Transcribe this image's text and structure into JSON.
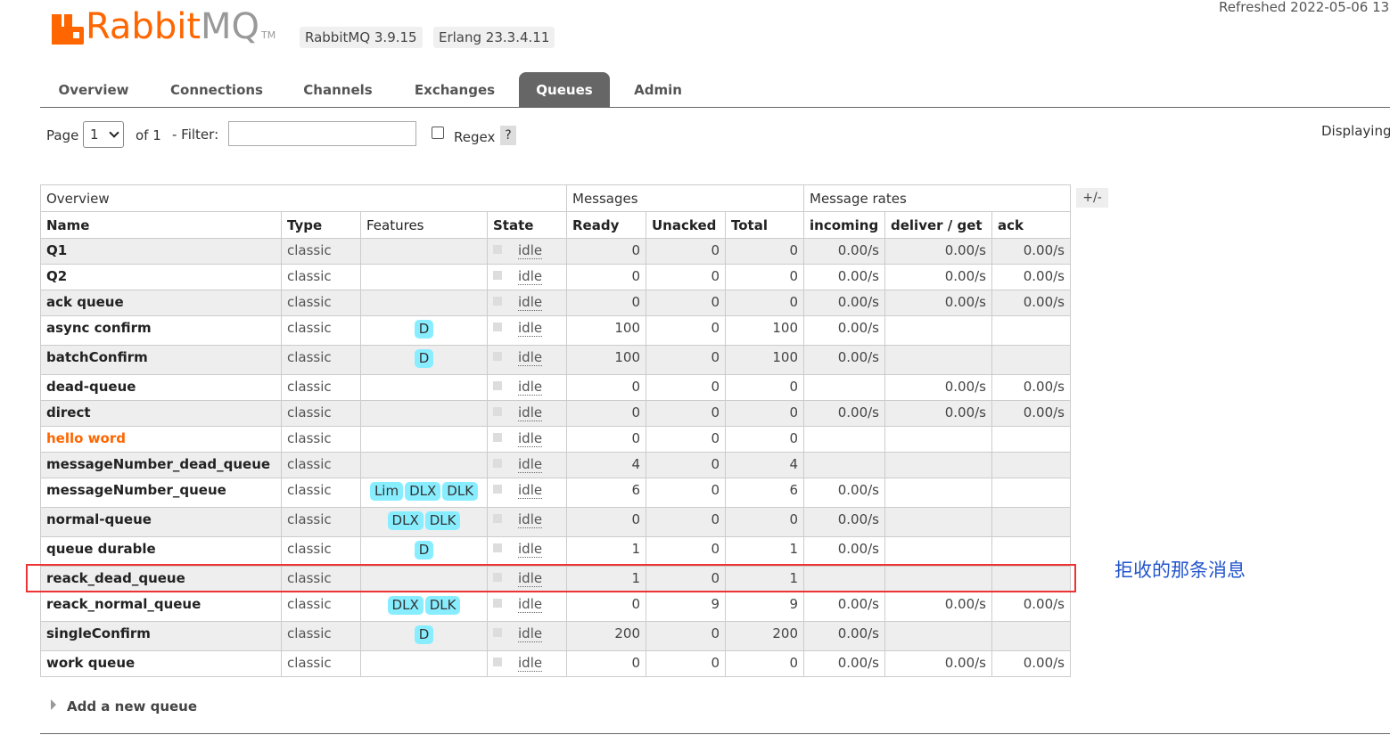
{
  "header": {
    "logo_main": "Rabbit",
    "logo_suffix": "MQ",
    "logo_tm": "TM",
    "rabbitmq_version": "RabbitMQ 3.9.15",
    "erlang_version": "Erlang 23.3.4.11",
    "refreshed": "Refreshed 2022-05-06 13"
  },
  "tabs": [
    "Overview",
    "Connections",
    "Channels",
    "Exchanges",
    "Queues",
    "Admin"
  ],
  "active_tab": "Queues",
  "controls": {
    "page_label": "Page",
    "page_value": "1",
    "of_label": "of 1",
    "filter_label": "- Filter:",
    "filter_value": "",
    "regex_label": "Regex",
    "help_label": "?",
    "displaying": "Displaying"
  },
  "table": {
    "group_headers": [
      "Overview",
      "Messages",
      "Message rates"
    ],
    "columns": [
      "Name",
      "Type",
      "Features",
      "State",
      "Ready",
      "Unacked",
      "Total",
      "incoming",
      "deliver / get",
      "ack"
    ],
    "plus_minus": "+/-",
    "rows": [
      {
        "name": "Q1",
        "type": "classic",
        "features": [],
        "state": "idle",
        "ready": "0",
        "unacked": "0",
        "total": "0",
        "incoming": "0.00/s",
        "deliver": "0.00/s",
        "ack": "0.00/s"
      },
      {
        "name": "Q2",
        "type": "classic",
        "features": [],
        "state": "idle",
        "ready": "0",
        "unacked": "0",
        "total": "0",
        "incoming": "0.00/s",
        "deliver": "0.00/s",
        "ack": "0.00/s"
      },
      {
        "name": "ack queue",
        "type": "classic",
        "features": [],
        "state": "idle",
        "ready": "0",
        "unacked": "0",
        "total": "0",
        "incoming": "0.00/s",
        "deliver": "0.00/s",
        "ack": "0.00/s"
      },
      {
        "name": "async confirm",
        "type": "classic",
        "features": [
          "D"
        ],
        "state": "idle",
        "ready": "100",
        "unacked": "0",
        "total": "100",
        "incoming": "0.00/s",
        "deliver": "",
        "ack": ""
      },
      {
        "name": "batchConfirm",
        "type": "classic",
        "features": [
          "D"
        ],
        "state": "idle",
        "ready": "100",
        "unacked": "0",
        "total": "100",
        "incoming": "0.00/s",
        "deliver": "",
        "ack": ""
      },
      {
        "name": "dead-queue",
        "type": "classic",
        "features": [],
        "state": "idle",
        "ready": "0",
        "unacked": "0",
        "total": "0",
        "incoming": "",
        "deliver": "0.00/s",
        "ack": "0.00/s"
      },
      {
        "name": "direct",
        "type": "classic",
        "features": [],
        "state": "idle",
        "ready": "0",
        "unacked": "0",
        "total": "0",
        "incoming": "0.00/s",
        "deliver": "0.00/s",
        "ack": "0.00/s"
      },
      {
        "name": "hello word",
        "type": "classic",
        "features": [],
        "state": "idle",
        "ready": "0",
        "unacked": "0",
        "total": "0",
        "incoming": "",
        "deliver": "",
        "ack": "",
        "highlight": true
      },
      {
        "name": "messageNumber_dead_queue",
        "type": "classic",
        "features": [],
        "state": "idle",
        "ready": "4",
        "unacked": "0",
        "total": "4",
        "incoming": "",
        "deliver": "",
        "ack": ""
      },
      {
        "name": "messageNumber_queue",
        "type": "classic",
        "features": [
          "Lim",
          "DLX",
          "DLK"
        ],
        "state": "idle",
        "ready": "6",
        "unacked": "0",
        "total": "6",
        "incoming": "0.00/s",
        "deliver": "",
        "ack": ""
      },
      {
        "name": "normal-queue",
        "type": "classic",
        "features": [
          "DLX",
          "DLK"
        ],
        "state": "idle",
        "ready": "0",
        "unacked": "0",
        "total": "0",
        "incoming": "0.00/s",
        "deliver": "",
        "ack": ""
      },
      {
        "name": "queue durable",
        "type": "classic",
        "features": [
          "D"
        ],
        "state": "idle",
        "ready": "1",
        "unacked": "0",
        "total": "1",
        "incoming": "0.00/s",
        "deliver": "",
        "ack": ""
      },
      {
        "name": "reack_dead_queue",
        "type": "classic",
        "features": [],
        "state": "idle",
        "ready": "1",
        "unacked": "0",
        "total": "1",
        "incoming": "",
        "deliver": "",
        "ack": ""
      },
      {
        "name": "reack_normal_queue",
        "type": "classic",
        "features": [
          "DLX",
          "DLK"
        ],
        "state": "idle",
        "ready": "0",
        "unacked": "9",
        "total": "9",
        "incoming": "0.00/s",
        "deliver": "0.00/s",
        "ack": "0.00/s"
      },
      {
        "name": "singleConfirm",
        "type": "classic",
        "features": [
          "D"
        ],
        "state": "idle",
        "ready": "200",
        "unacked": "0",
        "total": "200",
        "incoming": "0.00/s",
        "deliver": "",
        "ack": ""
      },
      {
        "name": "work queue",
        "type": "classic",
        "features": [],
        "state": "idle",
        "ready": "0",
        "unacked": "0",
        "total": "0",
        "incoming": "0.00/s",
        "deliver": "0.00/s",
        "ack": "0.00/s"
      }
    ]
  },
  "annotation": {
    "text": "拒收的那条消息",
    "box_color": "#e33333",
    "text_color": "#2255cc"
  },
  "add_queue_label": "Add a new queue",
  "colors": {
    "brand": "#ff6600",
    "tab_active_bg": "#666666",
    "feature_tag": "#88eeff"
  }
}
